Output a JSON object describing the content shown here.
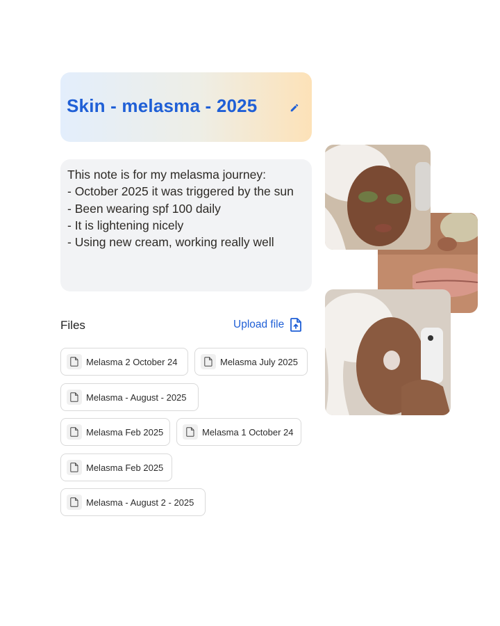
{
  "note": {
    "title": "Skin - melasma - 2025",
    "body_lines": [
      "This note is for my melasma journey:",
      "",
      "- October 2025 it was triggered by the sun",
      "- Been wearing spf 100 daily",
      "- It is lightening nicely",
      "- Using new cream, working really well"
    ]
  },
  "files": {
    "label": "Files",
    "upload_label": "Upload file",
    "items": [
      {
        "name": "Melasma 2 October 24"
      },
      {
        "name": "Melasma July 2025"
      },
      {
        "name": "Melasma - August - 2025"
      },
      {
        "name": "Melasma Feb 2025"
      },
      {
        "name": "Melasma 1 October 24"
      },
      {
        "name": "Melasma Feb 2025"
      },
      {
        "name": "Melasma - August 2 - 2025"
      }
    ]
  },
  "icons": {
    "edit": "pencil-icon",
    "upload": "file-upload-icon",
    "file": "document-icon"
  },
  "colors": {
    "accent": "#1f5fd6",
    "note_bg": "#f2f3f5",
    "title_gradient_start": "#e3eefc",
    "title_gradient_end": "#fde2b8"
  }
}
